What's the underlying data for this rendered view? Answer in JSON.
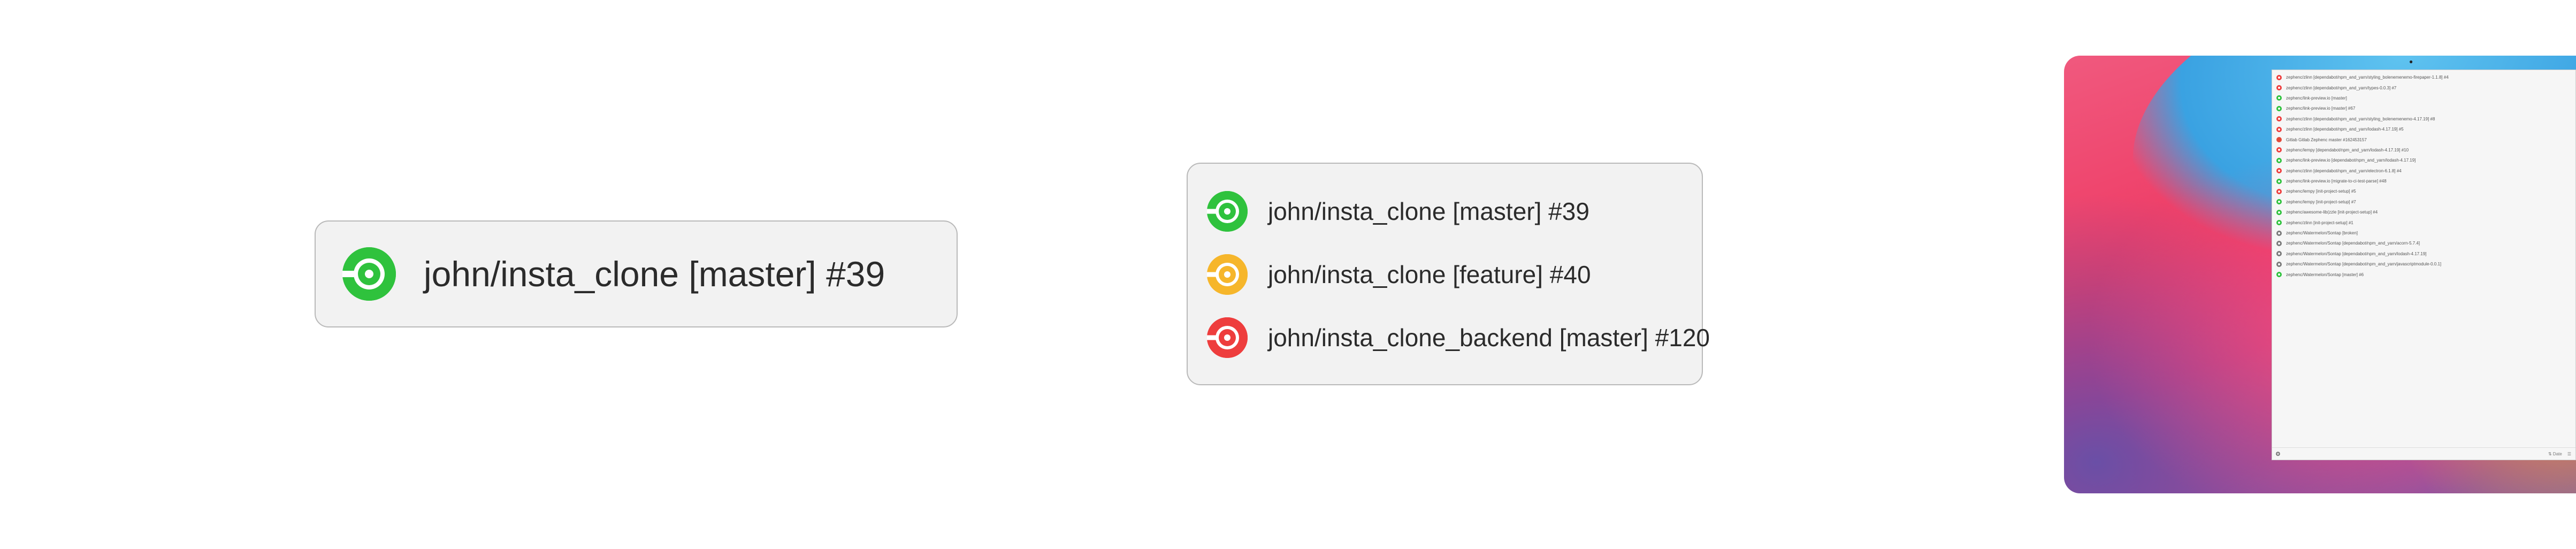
{
  "colors": {
    "success": "#2fc23d",
    "running": "#f6b62b",
    "failed": "#ee3d3d",
    "gitlab": "#e2493a",
    "neutral": "#7a7a7a"
  },
  "single_build": {
    "status": "success",
    "label": "john/insta_clone [master] #39"
  },
  "build_list": [
    {
      "status": "success",
      "label": "john/insta_clone [master] #39"
    },
    {
      "status": "running",
      "label": "john/insta_clone [feature] #40"
    },
    {
      "status": "failed",
      "label": "john/insta_clone_backend [master] #120"
    }
  ],
  "desktop": {
    "menubar_icon": "build-status-icon",
    "popover": {
      "rows": [
        {
          "status": "failed",
          "text": "zephenc/zlinn [dependabot/npm_and_yarn/styling_bolenemenemo-firepaper-1.1.8] #4"
        },
        {
          "status": "failed",
          "text": "zephenc/zlinn [dependabot/npm_and_yarn/types-0.0.3] #7"
        },
        {
          "status": "success",
          "text": "zephenc/link-preview.io [master]"
        },
        {
          "status": "success",
          "text": "zephenc/link-preview.io [master] #67"
        },
        {
          "status": "failed",
          "text": "zephenc/zlinn [dependabot/npm_and_yarn/styling_bolenemenemo-4.17.19] #8"
        },
        {
          "status": "failed",
          "text": "zephenc/zlinn [dependabot/npm_and_yarn/lodash-4.17.19] #5"
        },
        {
          "status": "gitlab",
          "text": "Gitlab Gitlab Zephenc master #162453157"
        },
        {
          "status": "failed",
          "text": "zephenc/lempy [dependabot/npm_and_yarn/lodash-4.17.19] #10"
        },
        {
          "status": "success",
          "text": "zephenc/link-preview.io [dependabot/npm_and_yarn/lodash-4.17.19]"
        },
        {
          "status": "failed",
          "text": "zephenc/zlinn [dependabot/npm_and_yarn/electron-6.1.8] #4"
        },
        {
          "status": "success",
          "text": "zephenc/link-preview.io [migrate-to-ci-test-parse] #48"
        },
        {
          "status": "failed",
          "text": "zephenc/lempy [init-project-setup] #5"
        },
        {
          "status": "success",
          "text": "zephenc/lempy [init-project-setup] #7"
        },
        {
          "status": "success",
          "text": "zephenc/awesome-lib(zzle [init-project-setup] #4"
        },
        {
          "status": "success",
          "text": "zephenc/zlinn [init-project-setup] #1"
        },
        {
          "status": "neutral",
          "text": "zephenc/Watermelon/Sontap [broken]"
        },
        {
          "status": "neutral",
          "text": "zephenc/Watermelon/Sontap [dependabot/npm_and_yarn/acorn-5.7.4]"
        },
        {
          "status": "neutral",
          "text": "zephenc/Watermelon/Sontap [dependabot/npm_and_yarn/lodash-4.17.19]"
        },
        {
          "status": "neutral",
          "text": "zephenc/Watermelon/Sontap [dependabot/npm_and_yarn/javascriptmodule-0.0.1]"
        },
        {
          "status": "success",
          "text": "zephenc/Watermelon/Sontap [master] #6"
        }
      ],
      "footer": {
        "settings_icon": "gear-icon",
        "sort_icon": "sort-icon",
        "sort_label": "Date",
        "layout_icon": "list-icon"
      }
    }
  }
}
